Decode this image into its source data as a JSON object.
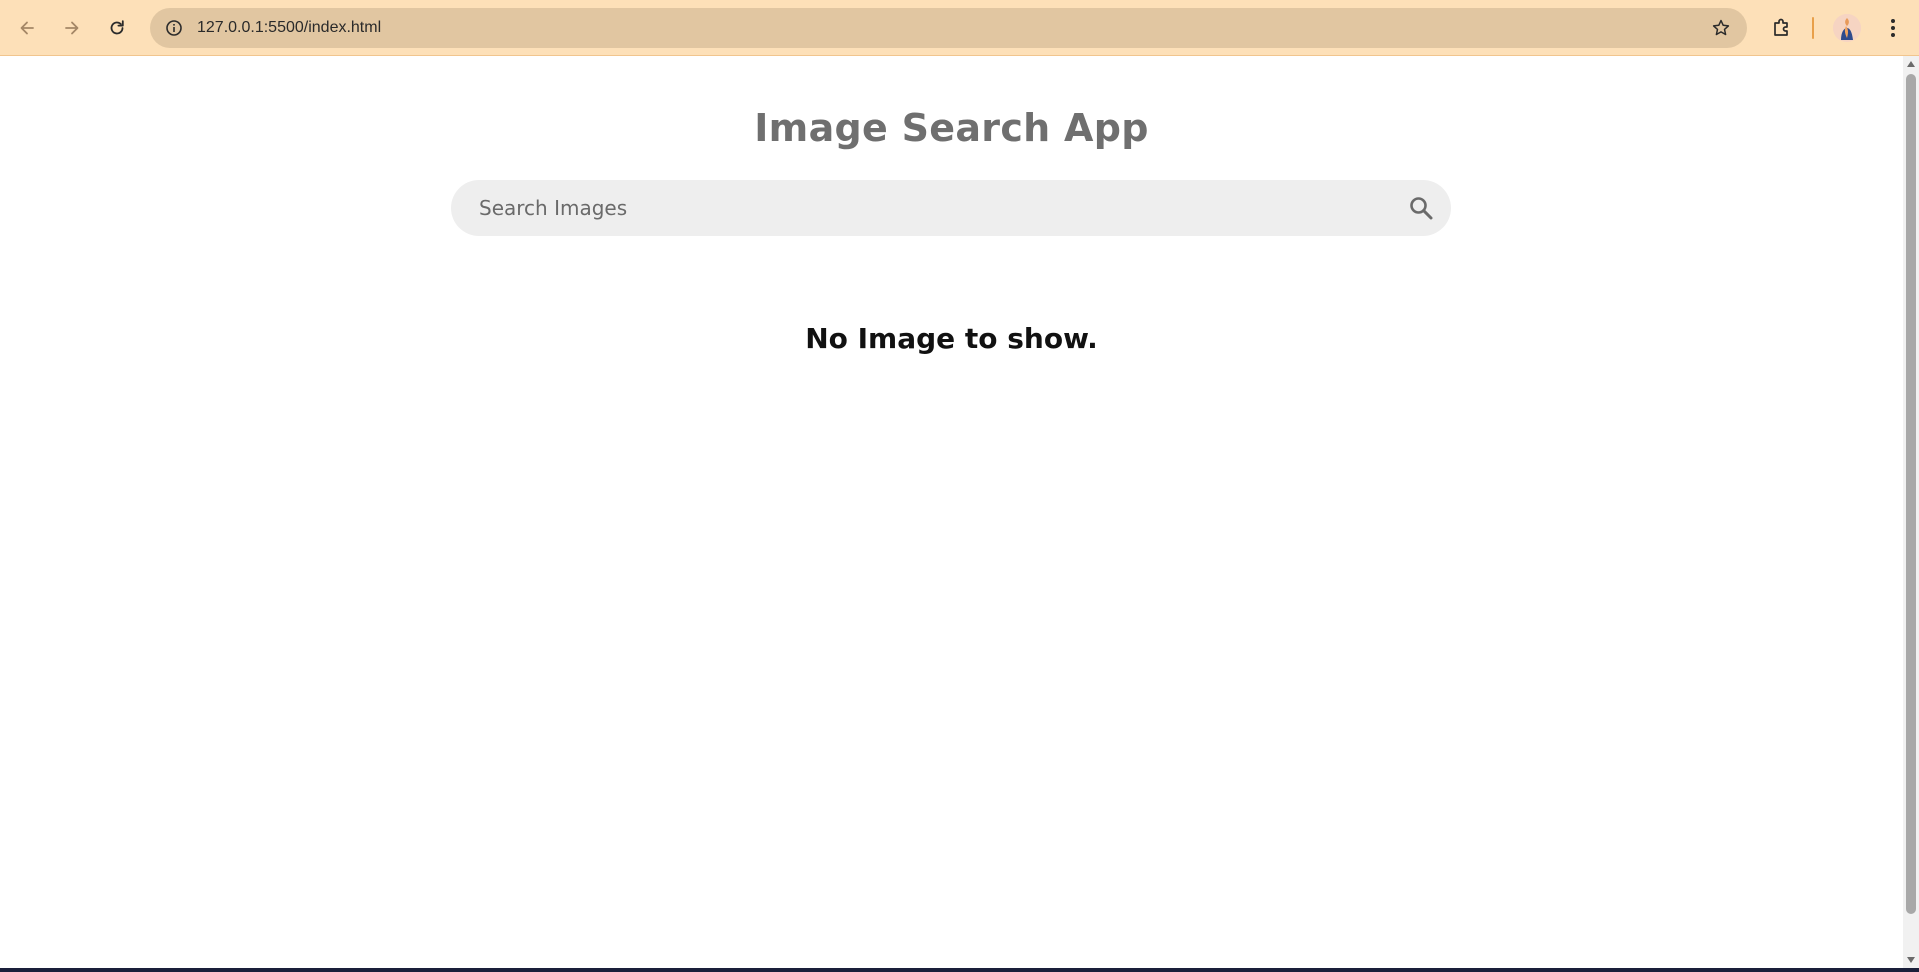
{
  "browser": {
    "url": "127.0.0.1:5500/index.html",
    "colors": {
      "chrome_bg": "#fde0b8",
      "omnibox_bg": "#e1c6a1",
      "divider": "#e8a04a"
    },
    "icons": {
      "back": "arrow-left-icon",
      "forward": "arrow-right-icon",
      "reload": "reload-icon",
      "site_info": "info-icon",
      "bookmark": "star-icon",
      "extensions": "puzzle-icon",
      "menu": "kebab-menu-icon"
    }
  },
  "app": {
    "title": "Image Search App",
    "search": {
      "placeholder": "Search Images",
      "value": "",
      "icon": "search-icon"
    },
    "empty_message": "No Image to show.",
    "colors": {
      "title": "#6f6f6f",
      "search_bg": "#eeeeee",
      "message": "#111111"
    }
  }
}
